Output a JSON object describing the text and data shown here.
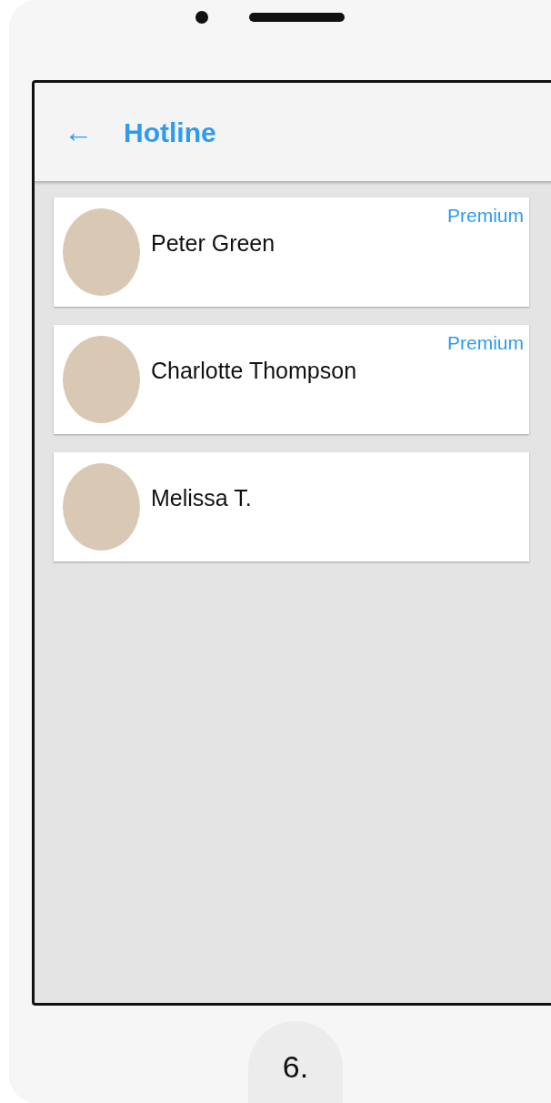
{
  "header": {
    "back_icon": "←",
    "title": "Hotline"
  },
  "contacts": [
    {
      "name": "Peter Green",
      "badge": "Premium"
    },
    {
      "name": "Charlotte Thompson",
      "badge": "Premium"
    },
    {
      "name": "Melissa T."
    }
  ],
  "caption": "6."
}
